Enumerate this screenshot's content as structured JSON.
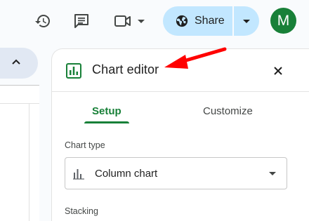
{
  "toolbar": {
    "history_icon": "history-icon",
    "comments_icon": "comments-icon",
    "meet_icon": "video-camera-icon",
    "share": {
      "label": "Share",
      "icon": "globe-icon",
      "color": "#c2e7ff"
    },
    "avatar": {
      "initial": "M",
      "color": "#188038"
    }
  },
  "chart_editor": {
    "title": "Chart editor",
    "icon": "chart-icon",
    "tabs": [
      {
        "label": "Setup",
        "active": true
      },
      {
        "label": "Customize",
        "active": false
      }
    ],
    "chart_type": {
      "label": "Chart type",
      "value": "Column chart",
      "icon": "column-chart-icon"
    },
    "stacking": {
      "label": "Stacking"
    }
  },
  "annotation": {
    "type": "red-arrow",
    "color": "#ff0000"
  },
  "accent_color": "#188038"
}
